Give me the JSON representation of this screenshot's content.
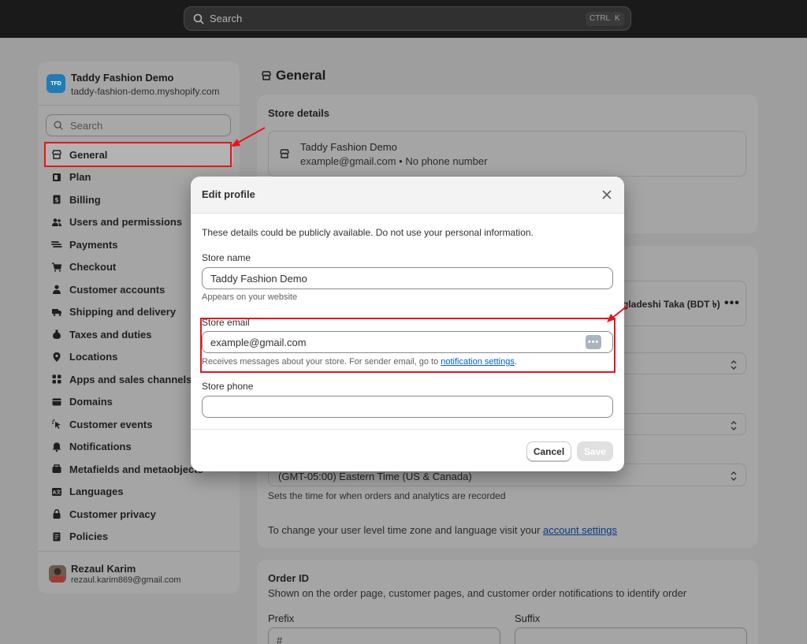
{
  "topbar": {
    "search_placeholder": "Search",
    "shortcut_key1": "CTRL",
    "shortcut_key2": "K"
  },
  "sidebar": {
    "store_initials": "TFD",
    "store_name": "Taddy Fashion Demo",
    "store_domain": "taddy-fashion-demo.myshopify.com",
    "search_placeholder": "Search",
    "items": [
      {
        "label": "General",
        "icon": "store-icon"
      },
      {
        "label": "Plan",
        "icon": "plan-icon"
      },
      {
        "label": "Billing",
        "icon": "billing-icon"
      },
      {
        "label": "Users and permissions",
        "icon": "users-icon"
      },
      {
        "label": "Payments",
        "icon": "payments-icon"
      },
      {
        "label": "Checkout",
        "icon": "cart-icon"
      },
      {
        "label": "Customer accounts",
        "icon": "person-icon"
      },
      {
        "label": "Shipping and delivery",
        "icon": "truck-icon"
      },
      {
        "label": "Taxes and duties",
        "icon": "taxes-icon"
      },
      {
        "label": "Locations",
        "icon": "location-icon"
      },
      {
        "label": "Apps and sales channels",
        "icon": "apps-icon"
      },
      {
        "label": "Domains",
        "icon": "globe-icon"
      },
      {
        "label": "Customer events",
        "icon": "cursor-icon"
      },
      {
        "label": "Notifications",
        "icon": "bell-icon"
      },
      {
        "label": "Metafields and metaobjects",
        "icon": "metafields-icon"
      },
      {
        "label": "Languages",
        "icon": "language-icon"
      },
      {
        "label": "Customer privacy",
        "icon": "lock-icon"
      },
      {
        "label": "Policies",
        "icon": "policies-icon"
      }
    ],
    "user_name": "Rezaul Karim",
    "user_email": "rezaul.karim869@gmail.com"
  },
  "main": {
    "title": "General",
    "store_details_title": "Store details",
    "store_name": "Taddy Fashion Demo",
    "store_contact": "example@gmail.com • No phone number",
    "currency_partial": "gladeshi Taka (BDT ৳)",
    "timezone_value": "(GMT-05:00) Eastern Time (US & Canada)",
    "timezone_help": "Sets the time for when orders and analytics are recorded",
    "account_line": "To change your user level time zone and language visit your ",
    "account_link": "account settings",
    "order_id_title": "Order ID",
    "order_id_sub": "Shown on the order page, customer pages, and customer order notifications to identify order",
    "prefix_label": "Prefix",
    "suffix_label": "Suffix",
    "prefix_value": "#"
  },
  "modal": {
    "title": "Edit profile",
    "intro": "These details could be publicly available. Do not use your personal information.",
    "store_name_label": "Store name",
    "store_name_value": "Taddy Fashion Demo",
    "store_name_help": "Appears on your website",
    "store_email_label": "Store email",
    "store_email_value": "example@gmail.com",
    "store_email_help": "Receives messages about your store. For sender email, go to ",
    "store_email_link": "notification settings",
    "store_email_help_end": ".",
    "store_phone_label": "Store phone",
    "cancel_label": "Cancel",
    "save_label": "Save"
  },
  "colors": {
    "annotation_red": "#e8141b",
    "link_blue": "#005bd3",
    "topbar": "#1a1a1a"
  }
}
